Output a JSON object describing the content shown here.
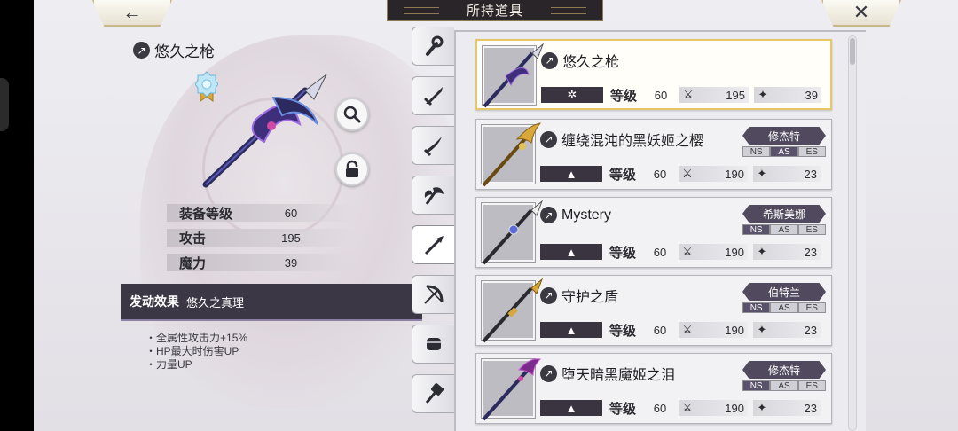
{
  "header": {
    "title": "所持道具",
    "back_icon": "arrow-left-icon",
    "close_icon": "close-x-icon"
  },
  "detail": {
    "name": "悠久之枪",
    "stats": [
      {
        "label": "装备等级",
        "value": "60"
      },
      {
        "label": "攻击",
        "value": "195"
      },
      {
        "label": "魔力",
        "value": "39"
      }
    ],
    "effect": {
      "title": "发动效果",
      "name": "悠久之真理",
      "lines": [
        "全属性攻击力+15%",
        "HP最大时伤害UP",
        "力量UP"
      ]
    }
  },
  "tabs": [
    "staff-icon",
    "sword-icon",
    "blade-icon",
    "axe-icon",
    "spear-icon",
    "bow-icon",
    "fist-icon",
    "hammer-icon"
  ],
  "active_tab": 4,
  "list": {
    "level_label": "等级",
    "items": [
      {
        "name": "悠久之枪",
        "rarity": "✲",
        "level": "60",
        "attack": "195",
        "magic": "39",
        "owner": "",
        "series": []
      },
      {
        "name": "缠绕混沌的黑妖姬之樱",
        "rarity": "",
        "level": "60",
        "attack": "190",
        "magic": "23",
        "owner": "修杰特",
        "series": [
          "NS",
          "AS",
          "ES"
        ],
        "series_active": "AS"
      },
      {
        "name": "Mystery",
        "rarity": "",
        "level": "60",
        "attack": "190",
        "magic": "23",
        "owner": "希斯美娜",
        "series": [
          "NS",
          "AS",
          "ES"
        ],
        "series_active": "NS"
      },
      {
        "name": "守护之盾",
        "rarity": "",
        "level": "60",
        "attack": "190",
        "magic": "23",
        "owner": "伯特兰",
        "series": [
          "NS",
          "AS",
          "ES"
        ],
        "series_active": "NS"
      },
      {
        "name": "堕天暗黑魔姬之泪",
        "rarity": "",
        "level": "60",
        "attack": "190",
        "magic": "23",
        "owner": "修杰特",
        "series": [
          "NS",
          "AS",
          "ES"
        ],
        "series_active": "NS"
      }
    ]
  },
  "colors": {
    "selected_border": "#e8c766",
    "tag_bg": "#514a5e",
    "effect_bar": "#3c3744"
  }
}
